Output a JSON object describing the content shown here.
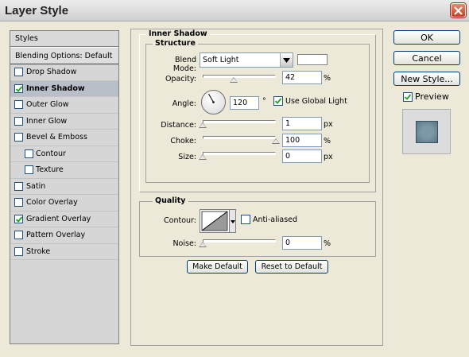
{
  "window": {
    "title": "Layer Style"
  },
  "styles_list": {
    "header": "Styles",
    "blending_options": "Blending Options: Default",
    "items": [
      {
        "label": "Drop Shadow",
        "checked": false,
        "sub": false,
        "active": false
      },
      {
        "label": "Inner Shadow",
        "checked": true,
        "sub": false,
        "active": true
      },
      {
        "label": "Outer Glow",
        "checked": false,
        "sub": false,
        "active": false
      },
      {
        "label": "Inner Glow",
        "checked": false,
        "sub": false,
        "active": false
      },
      {
        "label": "Bevel & Emboss",
        "checked": false,
        "sub": false,
        "active": false
      },
      {
        "label": "Contour",
        "checked": false,
        "sub": true,
        "active": false
      },
      {
        "label": "Texture",
        "checked": false,
        "sub": true,
        "active": false
      },
      {
        "label": "Satin",
        "checked": false,
        "sub": false,
        "active": false
      },
      {
        "label": "Color Overlay",
        "checked": false,
        "sub": false,
        "active": false
      },
      {
        "label": "Gradient Overlay",
        "checked": true,
        "sub": false,
        "active": false
      },
      {
        "label": "Pattern Overlay",
        "checked": false,
        "sub": false,
        "active": false
      },
      {
        "label": "Stroke",
        "checked": false,
        "sub": false,
        "active": false
      }
    ]
  },
  "inner_shadow": {
    "title": "Inner Shadow",
    "structure": {
      "title": "Structure",
      "blend_mode_label": "Blend Mode:",
      "blend_mode_value": "Soft Light",
      "blend_color": "#ffffff",
      "opacity_label": "Opacity:",
      "opacity_value": "42",
      "opacity_unit": "%",
      "angle_label": "Angle:",
      "angle_value": "120",
      "angle_unit": "°",
      "use_global_light_label": "Use Global Light",
      "use_global_light_checked": true,
      "distance_label": "Distance:",
      "distance_value": "1",
      "distance_unit": "px",
      "choke_label": "Choke:",
      "choke_value": "100",
      "choke_unit": "%",
      "size_label": "Size:",
      "size_value": "0",
      "size_unit": "px"
    },
    "quality": {
      "title": "Quality",
      "contour_label": "Contour:",
      "anti_aliased_label": "Anti-aliased",
      "anti_aliased_checked": false,
      "noise_label": "Noise:",
      "noise_value": "0",
      "noise_unit": "%"
    },
    "make_default_label": "Make Default",
    "reset_default_label": "Reset to Default"
  },
  "side_buttons": {
    "ok_label": "OK",
    "cancel_label": "Cancel",
    "new_style_label": "New Style...",
    "preview_label": "Preview",
    "preview_checked": true
  }
}
